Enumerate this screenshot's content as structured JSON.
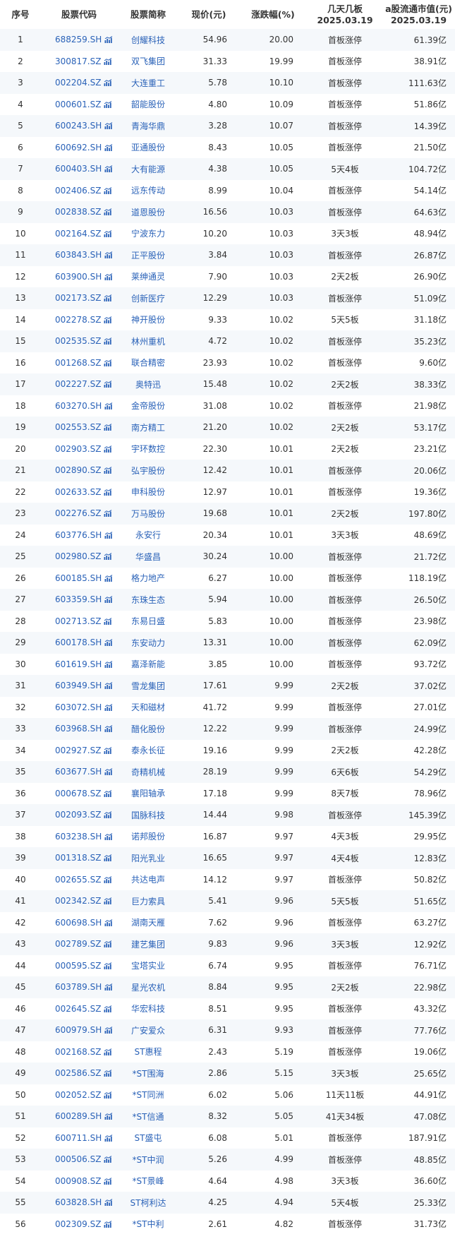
{
  "headers": {
    "idx": "序号",
    "code": "股票代码",
    "name": "股票简称",
    "price": "现价(元)",
    "change": "涨跌幅(%)",
    "boards_line1": "几天几板",
    "boards_line2": "2025.03.19",
    "cap_line1": "a股流通市值(元)",
    "cap_line2": "2025.03.19"
  },
  "colors": {
    "link": "#2a62b8",
    "up": "#e2231a",
    "stripe": "#f5f8fb"
  },
  "icons": {
    "code_chart": "trend-chart-icon"
  },
  "rows": [
    [
      "1",
      "688259.SH",
      "创耀科技",
      "54.96",
      "20.00",
      "首板涨停",
      "61.39亿"
    ],
    [
      "2",
      "300817.SZ",
      "双飞集团",
      "31.33",
      "19.99",
      "首板涨停",
      "38.91亿"
    ],
    [
      "3",
      "002204.SZ",
      "大连重工",
      "5.78",
      "10.10",
      "首板涨停",
      "111.63亿"
    ],
    [
      "4",
      "000601.SZ",
      "韶能股份",
      "4.80",
      "10.09",
      "首板涨停",
      "51.86亿"
    ],
    [
      "5",
      "600243.SH",
      "青海华鼎",
      "3.28",
      "10.07",
      "首板涨停",
      "14.39亿"
    ],
    [
      "6",
      "600692.SH",
      "亚通股份",
      "8.43",
      "10.05",
      "首板涨停",
      "21.50亿"
    ],
    [
      "7",
      "600403.SH",
      "大有能源",
      "4.38",
      "10.05",
      "5天4板",
      "104.72亿"
    ],
    [
      "8",
      "002406.SZ",
      "远东传动",
      "8.99",
      "10.04",
      "首板涨停",
      "54.14亿"
    ],
    [
      "9",
      "002838.SZ",
      "道恩股份",
      "16.56",
      "10.03",
      "首板涨停",
      "64.63亿"
    ],
    [
      "10",
      "002164.SZ",
      "宁波东力",
      "10.20",
      "10.03",
      "3天3板",
      "48.94亿"
    ],
    [
      "11",
      "603843.SH",
      "正平股份",
      "3.84",
      "10.03",
      "首板涨停",
      "26.87亿"
    ],
    [
      "12",
      "603900.SH",
      "莱绅通灵",
      "7.90",
      "10.03",
      "2天2板",
      "26.90亿"
    ],
    [
      "13",
      "002173.SZ",
      "创新医疗",
      "12.29",
      "10.03",
      "首板涨停",
      "51.09亿"
    ],
    [
      "14",
      "002278.SZ",
      "神开股份",
      "9.33",
      "10.02",
      "5天5板",
      "31.18亿"
    ],
    [
      "15",
      "002535.SZ",
      "林州重机",
      "4.72",
      "10.02",
      "首板涨停",
      "35.23亿"
    ],
    [
      "16",
      "001268.SZ",
      "联合精密",
      "23.93",
      "10.02",
      "首板涨停",
      "9.60亿"
    ],
    [
      "17",
      "002227.SZ",
      "奥特迅",
      "15.48",
      "10.02",
      "2天2板",
      "38.33亿"
    ],
    [
      "18",
      "603270.SH",
      "金帝股份",
      "31.08",
      "10.02",
      "首板涨停",
      "21.98亿"
    ],
    [
      "19",
      "002553.SZ",
      "南方精工",
      "21.20",
      "10.02",
      "2天2板",
      "53.17亿"
    ],
    [
      "20",
      "002903.SZ",
      "宇环数控",
      "22.30",
      "10.01",
      "2天2板",
      "23.21亿"
    ],
    [
      "21",
      "002890.SZ",
      "弘宇股份",
      "12.42",
      "10.01",
      "首板涨停",
      "20.06亿"
    ],
    [
      "22",
      "002633.SZ",
      "申科股份",
      "12.97",
      "10.01",
      "首板涨停",
      "19.36亿"
    ],
    [
      "23",
      "002276.SZ",
      "万马股份",
      "19.68",
      "10.01",
      "2天2板",
      "197.80亿"
    ],
    [
      "24",
      "603776.SH",
      "永安行",
      "20.34",
      "10.01",
      "3天3板",
      "48.69亿"
    ],
    [
      "25",
      "002980.SZ",
      "华盛昌",
      "30.24",
      "10.00",
      "首板涨停",
      "21.72亿"
    ],
    [
      "26",
      "600185.SH",
      "格力地产",
      "6.27",
      "10.00",
      "首板涨停",
      "118.19亿"
    ],
    [
      "27",
      "603359.SH",
      "东珠生态",
      "5.94",
      "10.00",
      "首板涨停",
      "26.50亿"
    ],
    [
      "28",
      "002713.SZ",
      "东易日盛",
      "5.83",
      "10.00",
      "首板涨停",
      "23.98亿"
    ],
    [
      "29",
      "600178.SH",
      "东安动力",
      "13.31",
      "10.00",
      "首板涨停",
      "62.09亿"
    ],
    [
      "30",
      "601619.SH",
      "嘉泽新能",
      "3.85",
      "10.00",
      "首板涨停",
      "93.72亿"
    ],
    [
      "31",
      "603949.SH",
      "雪龙集团",
      "17.61",
      "9.99",
      "2天2板",
      "37.02亿"
    ],
    [
      "32",
      "603072.SH",
      "天和磁材",
      "41.72",
      "9.99",
      "首板涨停",
      "27.01亿"
    ],
    [
      "33",
      "603968.SH",
      "醋化股份",
      "12.22",
      "9.99",
      "首板涨停",
      "24.99亿"
    ],
    [
      "34",
      "002927.SZ",
      "泰永长征",
      "19.16",
      "9.99",
      "2天2板",
      "42.28亿"
    ],
    [
      "35",
      "603677.SH",
      "奇精机械",
      "28.19",
      "9.99",
      "6天6板",
      "54.29亿"
    ],
    [
      "36",
      "000678.SZ",
      "襄阳轴承",
      "17.18",
      "9.99",
      "8天7板",
      "78.96亿"
    ],
    [
      "37",
      "002093.SZ",
      "国脉科技",
      "14.44",
      "9.98",
      "首板涨停",
      "145.39亿"
    ],
    [
      "38",
      "603238.SH",
      "诺邦股份",
      "16.87",
      "9.97",
      "4天3板",
      "29.95亿"
    ],
    [
      "39",
      "001318.SZ",
      "阳光乳业",
      "16.65",
      "9.97",
      "4天4板",
      "12.83亿"
    ],
    [
      "40",
      "002655.SZ",
      "共达电声",
      "14.12",
      "9.97",
      "首板涨停",
      "50.82亿"
    ],
    [
      "41",
      "002342.SZ",
      "巨力索具",
      "5.41",
      "9.96",
      "5天5板",
      "51.65亿"
    ],
    [
      "42",
      "600698.SH",
      "湖南天雁",
      "7.62",
      "9.96",
      "首板涨停",
      "63.27亿"
    ],
    [
      "43",
      "002789.SZ",
      "建艺集团",
      "9.83",
      "9.96",
      "3天3板",
      "12.92亿"
    ],
    [
      "44",
      "000595.SZ",
      "宝塔实业",
      "6.74",
      "9.95",
      "首板涨停",
      "76.71亿"
    ],
    [
      "45",
      "603789.SH",
      "星光农机",
      "8.84",
      "9.95",
      "2天2板",
      "22.98亿"
    ],
    [
      "46",
      "002645.SZ",
      "华宏科技",
      "8.51",
      "9.95",
      "首板涨停",
      "43.32亿"
    ],
    [
      "47",
      "600979.SH",
      "广安爱众",
      "6.31",
      "9.93",
      "首板涨停",
      "77.76亿"
    ],
    [
      "48",
      "002168.SZ",
      "ST惠程",
      "2.43",
      "5.19",
      "首板涨停",
      "19.06亿"
    ],
    [
      "49",
      "002586.SZ",
      "*ST围海",
      "2.86",
      "5.15",
      "3天3板",
      "25.65亿"
    ],
    [
      "50",
      "002052.SZ",
      "*ST同洲",
      "6.02",
      "5.06",
      "11天11板",
      "44.91亿"
    ],
    [
      "51",
      "600289.SH",
      "*ST信通",
      "8.32",
      "5.05",
      "41天34板",
      "47.08亿"
    ],
    [
      "52",
      "600711.SH",
      "ST盛屯",
      "6.08",
      "5.01",
      "首板涨停",
      "187.91亿"
    ],
    [
      "53",
      "000506.SZ",
      "*ST中润",
      "5.26",
      "4.99",
      "首板涨停",
      "48.85亿"
    ],
    [
      "54",
      "000908.SZ",
      "*ST景峰",
      "4.64",
      "4.98",
      "3天3板",
      "36.60亿"
    ],
    [
      "55",
      "603828.SH",
      "ST柯利达",
      "4.25",
      "4.94",
      "5天4板",
      "25.33亿"
    ],
    [
      "56",
      "002309.SZ",
      "*ST中利",
      "2.61",
      "4.82",
      "首板涨停",
      "31.73亿"
    ]
  ]
}
